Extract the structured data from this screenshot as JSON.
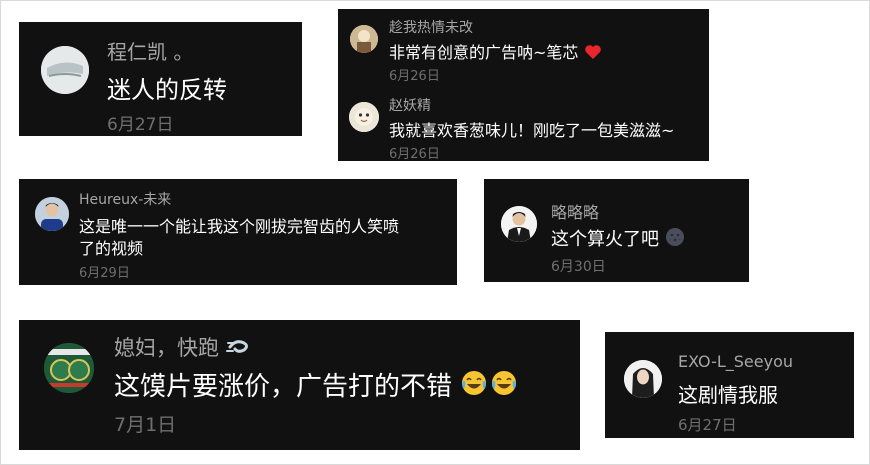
{
  "comments": [
    {
      "name": "程仁凯 。",
      "text": "迷人的反转",
      "date": "6月27日"
    },
    {
      "name": "趁我热情未改",
      "text": "非常有创意的广告呐~笔芯",
      "date": "6月26日",
      "emoji": "red-heart"
    },
    {
      "name": "赵妖精",
      "text": "我就喜欢香葱味儿！刚吃了一包美滋滋~",
      "date": "6月26日"
    },
    {
      "name": "Heureux-未来",
      "text_line1": "这是唯一一个能让我这个刚拔完智齿的人笑喷",
      "text_line2": "了的视频",
      "date": "6月29日"
    },
    {
      "name": "略略略",
      "text": "这个算火了吧",
      "date": "6月30日",
      "emoji": "new-moon-face"
    },
    {
      "name": "媳妇，快跑",
      "name_emoji": "dashing-away",
      "text": "这馍片要涨价，广告打的不错",
      "date": "7月1日",
      "emoji": "face-with-tears-of-joy"
    },
    {
      "name": "EXO-L_Seeyou",
      "text": "这剧情我服",
      "date": "6月27日"
    }
  ],
  "colors": {
    "card_bg": "#111111",
    "name": "#a6a6a6",
    "text": "#ffffff",
    "date": "#6f6f6f",
    "page_bg": "#ffffff"
  }
}
